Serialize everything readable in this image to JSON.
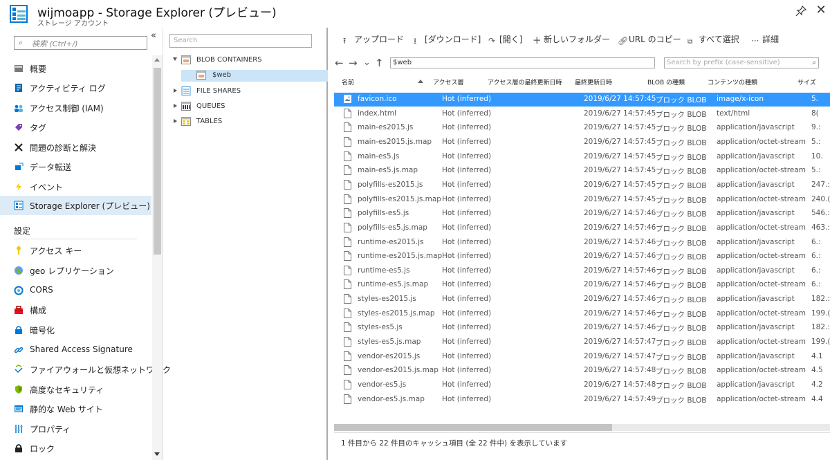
{
  "header": {
    "title": "wijmoapp - Storage Explorer (プレビュー)",
    "subtitle": "ストレージ アカウント",
    "accent": "#0078d4"
  },
  "nav": {
    "search_placeholder": "検索 (Ctrl+/)",
    "collapse_glyph": "«",
    "items": [
      {
        "label": "概要",
        "icon": "overview-icon"
      },
      {
        "label": "アクティビティ ログ",
        "icon": "activity-log-icon"
      },
      {
        "label": "アクセス制御 (IAM)",
        "icon": "iam-icon"
      },
      {
        "label": "タグ",
        "icon": "tag-icon"
      },
      {
        "label": "問題の診断と解決",
        "icon": "wrench-icon"
      },
      {
        "label": "データ転送",
        "icon": "data-transfer-icon"
      },
      {
        "label": "イベント",
        "icon": "lightning-icon"
      },
      {
        "label": "Storage Explorer (プレビュー)",
        "icon": "storage-explorer-icon"
      }
    ],
    "settings_label": "設定",
    "settings_items": [
      {
        "label": "アクセス キー",
        "icon": "key-icon"
      },
      {
        "label": "geo レプリケーション",
        "icon": "globe-icon"
      },
      {
        "label": "CORS",
        "icon": "cors-icon"
      },
      {
        "label": "構成",
        "icon": "toolbox-icon"
      },
      {
        "label": "暗号化",
        "icon": "lock-icon"
      },
      {
        "label": "Shared Access Signature",
        "icon": "link-icon"
      },
      {
        "label": "ファイアウォールと仮想ネットワーク",
        "icon": "firewall-icon"
      },
      {
        "label": "高度なセキュリティ",
        "icon": "shield-icon"
      },
      {
        "label": "静的な Web サイト",
        "icon": "static-website-icon"
      },
      {
        "label": "プロパティ",
        "icon": "properties-icon"
      },
      {
        "label": "ロック",
        "icon": "padlock-icon"
      }
    ]
  },
  "tree": {
    "search_placeholder": "Search",
    "blob_containers": "BLOB CONTAINERS",
    "web": "$web",
    "file_shares": "FILE SHARES",
    "queues": "QUEUES",
    "tables": "TABLES"
  },
  "toolbar": {
    "upload": "アップロード",
    "download": "[ダウンロード]",
    "open": "[開く]",
    "new_folder": "新しいフォルダー",
    "copy_url": "URL のコピー",
    "select_all": "すべて選択",
    "details": "詳細"
  },
  "address": {
    "path": "$web",
    "prefix_placeholder": "Search by prefix (case-sensitive)"
  },
  "columns": {
    "name": "名前",
    "access_tier": "アクセス層",
    "tier_modified": "アクセス層の最終更新日時",
    "last_modified": "最終更新日時",
    "blob_type": "BLOB の種類",
    "content_type": "コンテンツの種類",
    "size": "サイズ"
  },
  "files": [
    {
      "name": "favicon.ico",
      "tier": "Hot (inferred)",
      "modified": "2019/6/27 14:57:45",
      "type": "ブロック BLOB",
      "content": "image/x-icon",
      "size": "5.",
      "icon": "image-file-icon"
    },
    {
      "name": "index.html",
      "tier": "Hot (inferred)",
      "modified": "2019/6/27 14:57:45",
      "type": "ブロック BLOB",
      "content": "text/html",
      "size": "8(",
      "icon": "file-icon"
    },
    {
      "name": "main-es2015.js",
      "tier": "Hot (inferred)",
      "modified": "2019/6/27 14:57:45",
      "type": "ブロック BLOB",
      "content": "application/javascript",
      "size": "9.:",
      "icon": "file-icon"
    },
    {
      "name": "main-es2015.js.map",
      "tier": "Hot (inferred)",
      "modified": "2019/6/27 14:57:45",
      "type": "ブロック BLOB",
      "content": "application/octet-stream",
      "size": "5.:",
      "icon": "file-icon"
    },
    {
      "name": "main-es5.js",
      "tier": "Hot (inferred)",
      "modified": "2019/6/27 14:57:45",
      "type": "ブロック BLOB",
      "content": "application/javascript",
      "size": "10.",
      "icon": "file-icon"
    },
    {
      "name": "main-es5.js.map",
      "tier": "Hot (inferred)",
      "modified": "2019/6/27 14:57:45",
      "type": "ブロック BLOB",
      "content": "application/octet-stream",
      "size": "5.:",
      "icon": "file-icon"
    },
    {
      "name": "polyfills-es2015.js",
      "tier": "Hot (inferred)",
      "modified": "2019/6/27 14:57:45",
      "type": "ブロック BLOB",
      "content": "application/javascript",
      "size": "247.:",
      "icon": "file-icon"
    },
    {
      "name": "polyfills-es2015.js.map",
      "tier": "Hot (inferred)",
      "modified": "2019/6/27 14:57:45",
      "type": "ブロック BLOB",
      "content": "application/octet-stream",
      "size": "240.(",
      "icon": "file-icon"
    },
    {
      "name": "polyfills-es5.js",
      "tier": "Hot (inferred)",
      "modified": "2019/6/27 14:57:46",
      "type": "ブロック BLOB",
      "content": "application/javascript",
      "size": "546.:",
      "icon": "file-icon"
    },
    {
      "name": "polyfills-es5.js.map",
      "tier": "Hot (inferred)",
      "modified": "2019/6/27 14:57:46",
      "type": "ブロック BLOB",
      "content": "application/octet-stream",
      "size": "463.:",
      "icon": "file-icon"
    },
    {
      "name": "runtime-es2015.js",
      "tier": "Hot (inferred)",
      "modified": "2019/6/27 14:57:46",
      "type": "ブロック BLOB",
      "content": "application/javascript",
      "size": "6.:",
      "icon": "file-icon"
    },
    {
      "name": "runtime-es2015.js.map",
      "tier": "Hot (inferred)",
      "modified": "2019/6/27 14:57:46",
      "type": "ブロック BLOB",
      "content": "application/octet-stream",
      "size": "6.:",
      "icon": "file-icon"
    },
    {
      "name": "runtime-es5.js",
      "tier": "Hot (inferred)",
      "modified": "2019/6/27 14:57:46",
      "type": "ブロック BLOB",
      "content": "application/javascript",
      "size": "6.:",
      "icon": "file-icon"
    },
    {
      "name": "runtime-es5.js.map",
      "tier": "Hot (inferred)",
      "modified": "2019/6/27 14:57:46",
      "type": "ブロック BLOB",
      "content": "application/octet-stream",
      "size": "6.:",
      "icon": "file-icon"
    },
    {
      "name": "styles-es2015.js",
      "tier": "Hot (inferred)",
      "modified": "2019/6/27 14:57:46",
      "type": "ブロック BLOB",
      "content": "application/javascript",
      "size": "182.:",
      "icon": "file-icon"
    },
    {
      "name": "styles-es2015.js.map",
      "tier": "Hot (inferred)",
      "modified": "2019/6/27 14:57:46",
      "type": "ブロック BLOB",
      "content": "application/octet-stream",
      "size": "199.(",
      "icon": "file-icon"
    },
    {
      "name": "styles-es5.js",
      "tier": "Hot (inferred)",
      "modified": "2019/6/27 14:57:46",
      "type": "ブロック BLOB",
      "content": "application/javascript",
      "size": "182.:",
      "icon": "file-icon"
    },
    {
      "name": "styles-es5.js.map",
      "tier": "Hot (inferred)",
      "modified": "2019/6/27 14:57:47",
      "type": "ブロック BLOB",
      "content": "application/octet-stream",
      "size": "199.(",
      "icon": "file-icon"
    },
    {
      "name": "vendor-es2015.js",
      "tier": "Hot (inferred)",
      "modified": "2019/6/27 14:57:47",
      "type": "ブロック BLOB",
      "content": "application/javascript",
      "size": "4.1",
      "icon": "file-icon"
    },
    {
      "name": "vendor-es2015.js.map",
      "tier": "Hot (inferred)",
      "modified": "2019/6/27 14:57:48",
      "type": "ブロック BLOB",
      "content": "application/octet-stream",
      "size": "4.5",
      "icon": "file-icon"
    },
    {
      "name": "vendor-es5.js",
      "tier": "Hot (inferred)",
      "modified": "2019/6/27 14:57:48",
      "type": "ブロック BLOB",
      "content": "application/javascript",
      "size": "4.2",
      "icon": "file-icon"
    },
    {
      "name": "vendor-es5.js.map",
      "tier": "Hot (inferred)",
      "modified": "2019/6/27 14:57:49",
      "type": "ブロック BLOB",
      "content": "application/octet-stream",
      "size": "4.4",
      "icon": "file-icon"
    }
  ],
  "selected_index": 0,
  "status": "1 件目から 22 件目のキャッシュ項目 (全 22 件中) を表示しています",
  "colors": {
    "selection": "#3399ff",
    "nav_active": "#ddebf7",
    "tree_selected": "#cce4f7"
  }
}
